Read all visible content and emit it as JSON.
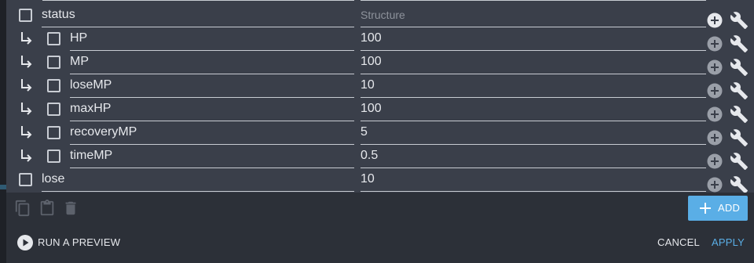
{
  "rows": [
    {
      "name": "status",
      "value": "Structure",
      "child": false,
      "placeholder": true
    },
    {
      "name": "HP",
      "value": "100",
      "child": true,
      "placeholder": false
    },
    {
      "name": "MP",
      "value": "100",
      "child": true,
      "placeholder": false
    },
    {
      "name": "loseMP",
      "value": "10",
      "child": true,
      "placeholder": false
    },
    {
      "name": "maxHP",
      "value": "100",
      "child": true,
      "placeholder": false
    },
    {
      "name": "recoveryMP",
      "value": "5",
      "child": true,
      "placeholder": false
    },
    {
      "name": "timeMP",
      "value": "0.5",
      "child": true,
      "placeholder": false
    },
    {
      "name": "lose",
      "value": "10",
      "child": false,
      "placeholder": false
    }
  ],
  "toolbar": {
    "add_label": "ADD",
    "run_preview_label": "RUN A PREVIEW",
    "cancel_label": "CANCEL",
    "apply_label": "APPLY"
  },
  "icons": {
    "copy": "copy-icon",
    "paste": "paste-icon",
    "delete": "trash-icon",
    "add_row": "add-circle-icon",
    "settings": "wrench-icon",
    "child_arrow": "child-arrow-icon",
    "play": "play-icon",
    "plus": "plus-icon"
  },
  "colors": {
    "accent": "#5aaee6",
    "row_background": "#3a3f4a",
    "panel_background": "#2c3038"
  }
}
